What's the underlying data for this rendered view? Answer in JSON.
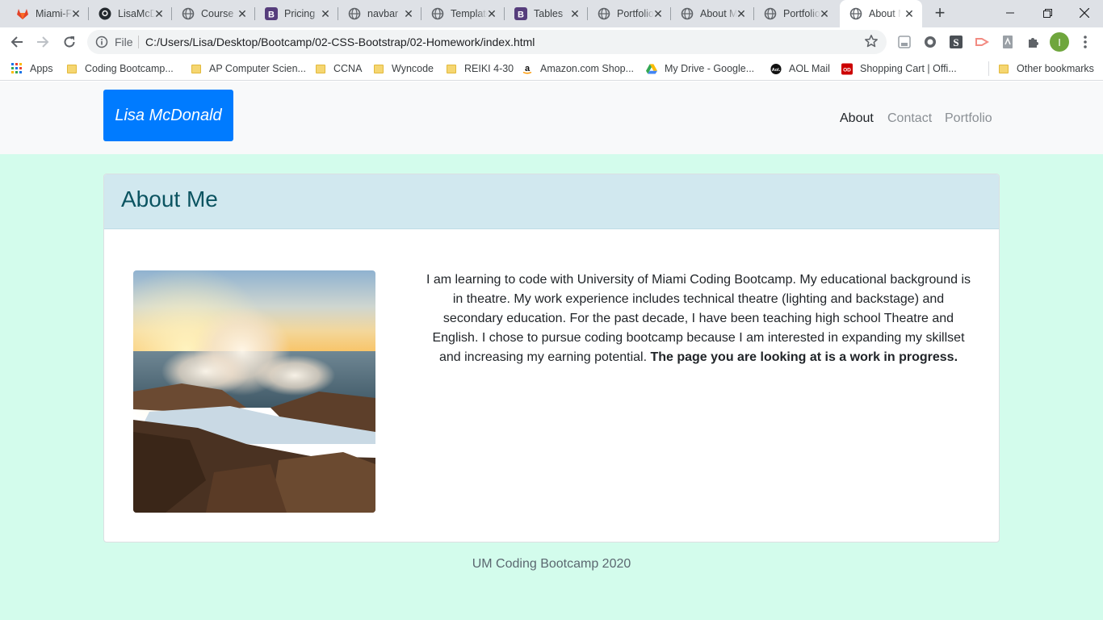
{
  "browser": {
    "tabs": [
      {
        "title": "Miami-FL",
        "icon": "gitlab-icon"
      },
      {
        "title": "LisaMcDonald",
        "icon": "github-icon"
      },
      {
        "title": "Course",
        "icon": "globe-icon"
      },
      {
        "title": "Pricing",
        "icon": "bootstrap-icon"
      },
      {
        "title": "navbar",
        "icon": "globe-icon"
      },
      {
        "title": "Templates",
        "icon": "globe-icon"
      },
      {
        "title": "Tables",
        "icon": "bootstrap-icon"
      },
      {
        "title": "Portfolio",
        "icon": "globe-icon"
      },
      {
        "title": "About Me",
        "icon": "globe-icon"
      },
      {
        "title": "Portfolio",
        "icon": "globe-icon"
      },
      {
        "title": "About Me",
        "icon": "globe-icon"
      }
    ],
    "active_tab": 10,
    "address": {
      "scheme_label": "File",
      "url": "C:/Users/Lisa/Desktop/Bootcamp/02-CSS-Bootstrap/02-Homework/index.html"
    },
    "profile_initial": "I",
    "bookmarks": [
      {
        "label": "Apps",
        "icon": "apps-grid-icon"
      },
      {
        "label": "Coding Bootcamp...",
        "icon": "folder-icon"
      },
      {
        "label": "AP Computer Scien...",
        "icon": "folder-icon"
      },
      {
        "label": "CCNA",
        "icon": "folder-icon"
      },
      {
        "label": "Wyncode",
        "icon": "folder-icon"
      },
      {
        "label": "REIKI 4-30",
        "icon": "folder-icon"
      },
      {
        "label": "Amazon.com Shop...",
        "icon": "amazon-icon"
      },
      {
        "label": "My Drive - Google...",
        "icon": "google-drive-icon"
      },
      {
        "label": "AOL Mail",
        "icon": "aol-icon"
      },
      {
        "label": "Shopping Cart | Offi...",
        "icon": "office-depot-icon"
      },
      {
        "label": "Other bookmarks",
        "icon": "folder-icon"
      }
    ]
  },
  "site": {
    "brand": "Lisa McDonald",
    "nav": [
      {
        "label": "About",
        "active": true
      },
      {
        "label": "Contact",
        "active": false
      },
      {
        "label": "Portfolio",
        "active": false
      }
    ],
    "about": {
      "title": "About Me",
      "bio": "I am learning to code with University of Miami Coding Bootcamp. My educational background is in theatre. My work experience includes technical theatre (lighting and backstage) and secondary education. For the past decade, I have been teaching high school Theatre and English. I chose to pursue coding bootcamp because I am interested in expanding my skillset and increasing my earning potential.",
      "bio_emphasis": "The page you are looking at is a work in progress."
    },
    "footer": "UM Coding Bootcamp 2020"
  },
  "colors": {
    "page_bg": "#d3fcec",
    "brand_bg": "#007bff",
    "card_header_bg": "#d1e8ef",
    "card_title": "#0b5461",
    "nav_active": "#212529",
    "nav_inactive": "#8a8f94"
  }
}
